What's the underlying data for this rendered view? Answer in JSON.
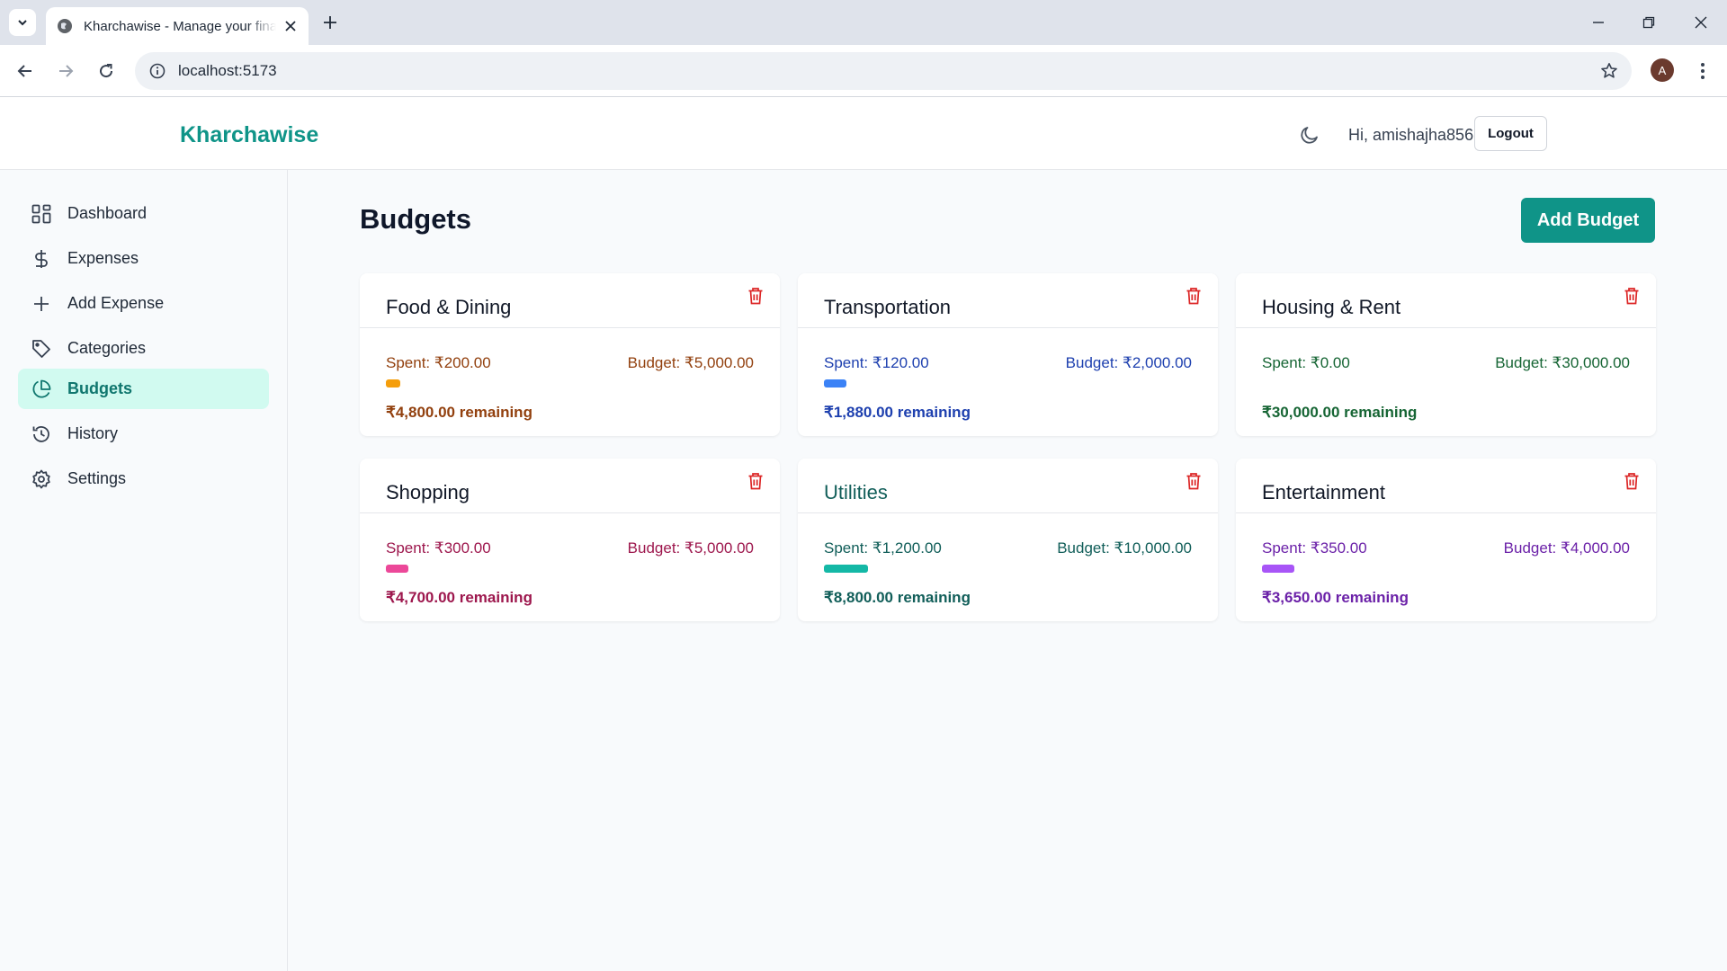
{
  "browser": {
    "tab_title": "Kharchawise - Manage your finances",
    "url": "localhost:5173",
    "profile_initial": "A"
  },
  "header": {
    "brand": "Kharchawise",
    "greeting": "Hi, amishajha856",
    "logout_label": "Logout"
  },
  "sidebar": {
    "items": [
      {
        "label": "Dashboard",
        "icon": "dashboard-icon"
      },
      {
        "label": "Expenses",
        "icon": "dollar-icon"
      },
      {
        "label": "Add Expense",
        "icon": "plus-icon"
      },
      {
        "label": "Categories",
        "icon": "tag-icon"
      },
      {
        "label": "Budgets",
        "icon": "pie-chart-icon",
        "active": true
      },
      {
        "label": "History",
        "icon": "history-icon"
      },
      {
        "label": "Settings",
        "icon": "gear-icon"
      }
    ]
  },
  "main": {
    "title": "Budgets",
    "add_button_label": "Add Budget",
    "budgets": [
      {
        "name": "Food & Dining",
        "spent": "Spent: ₹200.00",
        "budget": "Budget: ₹5,000.00",
        "remaining": "₹4,800.00 remaining",
        "progress": 0.04,
        "color": "#f59e0b",
        "text_color": "#92400e",
        "title_color": "#111827"
      },
      {
        "name": "Transportation",
        "spent": "Spent: ₹120.00",
        "budget": "Budget: ₹2,000.00",
        "remaining": "₹1,880.00 remaining",
        "progress": 0.06,
        "color": "#3b82f6",
        "text_color": "#1e40af",
        "title_color": "#111827"
      },
      {
        "name": "Housing & Rent",
        "spent": "Spent: ₹0.00",
        "budget": "Budget: ₹30,000.00",
        "remaining": "₹30,000.00 remaining",
        "progress": 0,
        "color": "#22c55e",
        "text_color": "#166534",
        "title_color": "#111827"
      },
      {
        "name": "Shopping",
        "spent": "Spent: ₹300.00",
        "budget": "Budget: ₹5,000.00",
        "remaining": "₹4,700.00 remaining",
        "progress": 0.06,
        "color": "#ec4899",
        "text_color": "#9d174d",
        "title_color": "#111827"
      },
      {
        "name": "Utilities",
        "spent": "Spent: ₹1,200.00",
        "budget": "Budget: ₹10,000.00",
        "remaining": "₹8,800.00 remaining",
        "progress": 0.12,
        "color": "#14b8a6",
        "text_color": "#115e59",
        "title_color": "#115e59"
      },
      {
        "name": "Entertainment",
        "spent": "Spent: ₹350.00",
        "budget": "Budget: ₹4,000.00",
        "remaining": "₹3,650.00 remaining",
        "progress": 0.0875,
        "color": "#a855f7",
        "text_color": "#6b21a8",
        "title_color": "#111827"
      }
    ]
  },
  "colors": {
    "brand": "#0f9488",
    "delete": "#dc2626",
    "active_nav_bg": "#d1faf0"
  }
}
